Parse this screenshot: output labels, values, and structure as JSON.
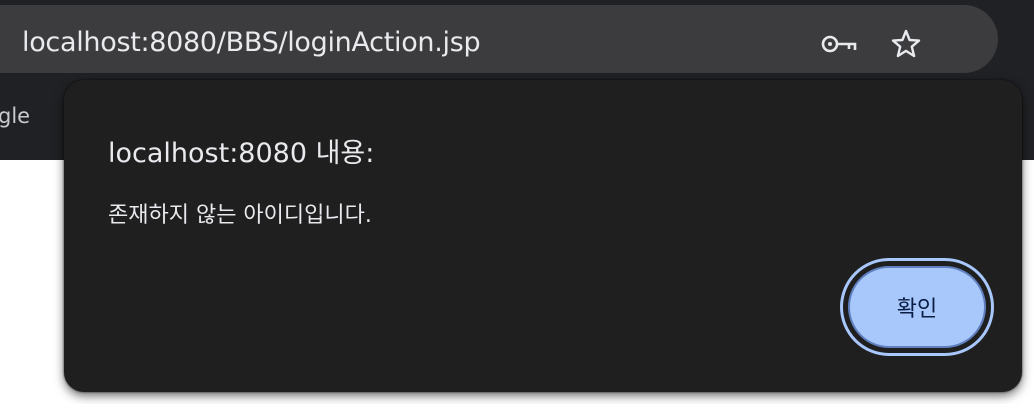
{
  "address_bar": {
    "url": "localhost:8080/BBS/loginAction.jsp",
    "info_icon": "info-icon",
    "key_icon": "key-icon",
    "star_icon": "star-icon"
  },
  "bookmarks_bar": {
    "partial_label": "gle"
  },
  "dialog": {
    "title": "localhost:8080 내용:",
    "message": "존재하지 않는 아이디입니다.",
    "ok_label": "확인"
  },
  "colors": {
    "browser_chrome": "#202124",
    "omnibox": "#3c3c3f",
    "dialog_bg": "#1f1f20",
    "button_accent": "#a8c7fa",
    "text": "#e8eaed"
  }
}
